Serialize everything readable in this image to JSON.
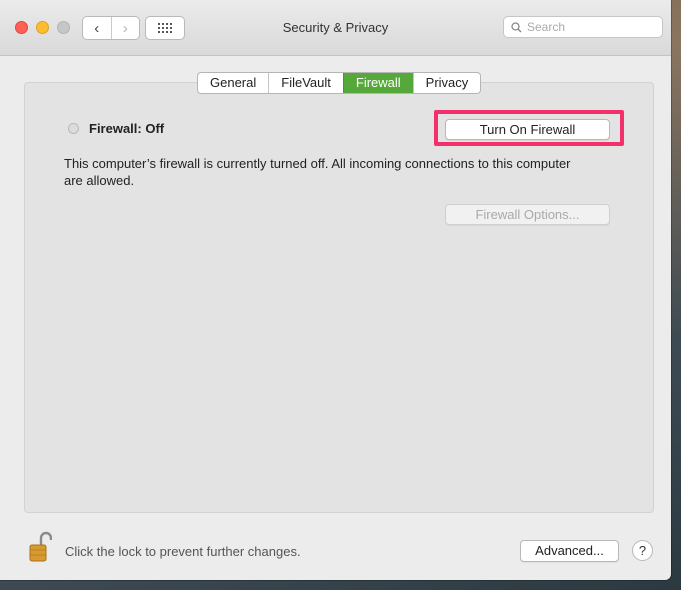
{
  "window": {
    "title": "Security & Privacy"
  },
  "toolbar": {
    "back_glyph": "‹",
    "forward_glyph": "›",
    "search_placeholder": "Search"
  },
  "tabs": [
    {
      "label": "General",
      "active": false
    },
    {
      "label": "FileVault",
      "active": false
    },
    {
      "label": "Firewall",
      "active": true
    },
    {
      "label": "Privacy",
      "active": false
    }
  ],
  "firewall": {
    "status": "Firewall: Off",
    "turn_on_label": "Turn On Firewall",
    "description": "This computer’s firewall is currently turned off. All incoming connections to this computer are allowed.",
    "options_label": "Firewall Options..."
  },
  "footer": {
    "lock_text": "Click the lock to prevent further changes.",
    "advanced_label": "Advanced...",
    "help_label": "?"
  },
  "colors": {
    "active_tab": "#56a83b",
    "highlight": "#f4306b",
    "close": "#fe5f57",
    "minimize": "#febc2e"
  }
}
